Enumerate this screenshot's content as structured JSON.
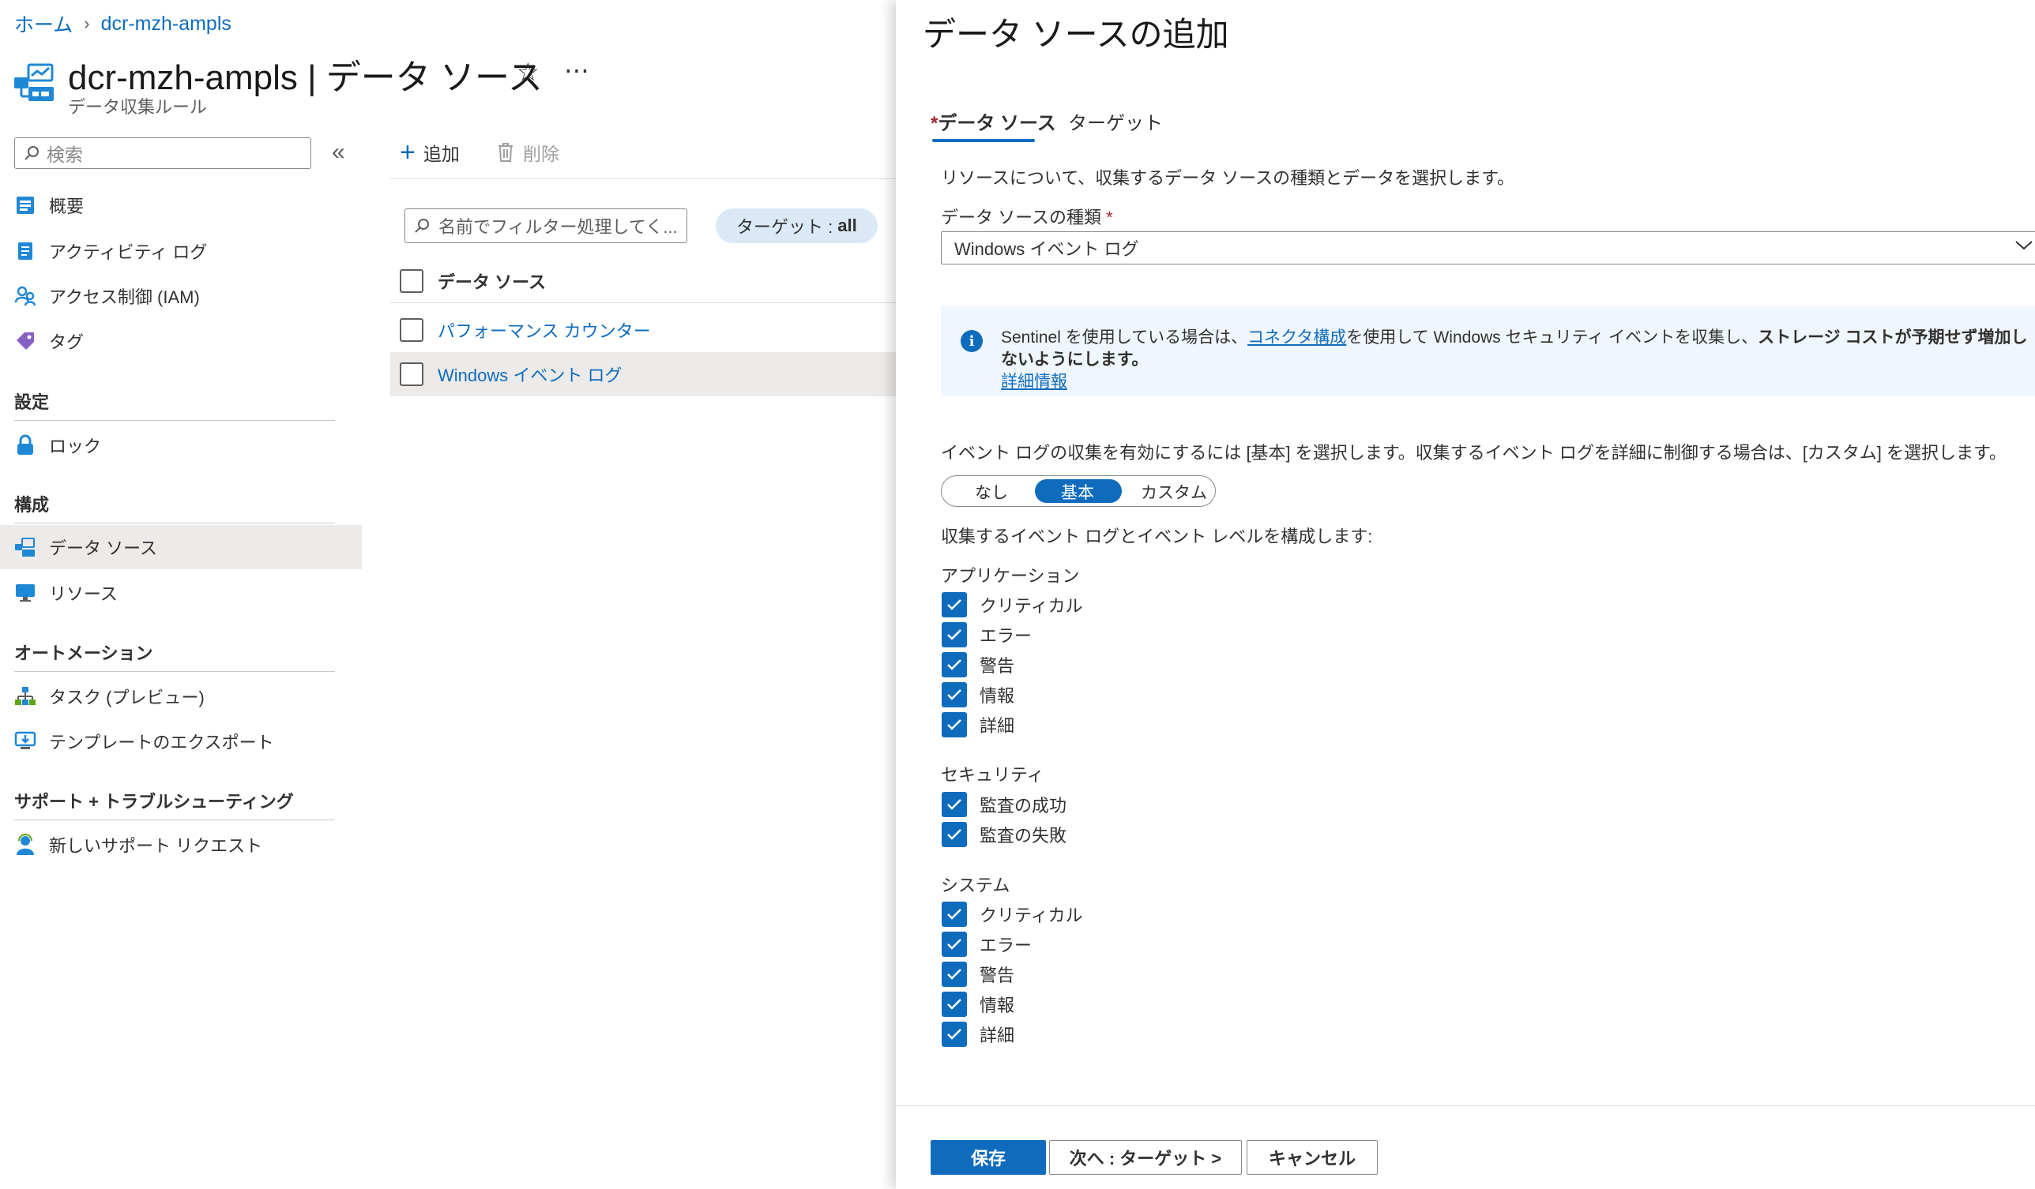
{
  "breadcrumb": {
    "home": "ホーム",
    "resource": "dcr-mzh-ampls"
  },
  "header": {
    "title": "dcr-mzh-ampls | データ ソース",
    "subtitle": "データ収集ルール"
  },
  "sidebar": {
    "search_placeholder": "検索",
    "items_top": [
      {
        "label": "概要",
        "icon": "overview-icon"
      },
      {
        "label": "アクティビティ ログ",
        "icon": "activity-log-icon"
      },
      {
        "label": "アクセス制御 (IAM)",
        "icon": "iam-icon"
      },
      {
        "label": "タグ",
        "icon": "tag-icon"
      }
    ],
    "sections": {
      "settings": "設定",
      "config": "構成",
      "automation": "オートメーション",
      "support": "サポート + トラブルシューティング"
    },
    "settings_items": [
      {
        "label": "ロック",
        "icon": "lock-icon"
      }
    ],
    "config_items": [
      {
        "label": "データ ソース",
        "icon": "data-source-icon",
        "active": true
      },
      {
        "label": "リソース",
        "icon": "resource-icon"
      }
    ],
    "automation_items": [
      {
        "label": "タスク (プレビュー)",
        "icon": "tasks-icon"
      },
      {
        "label": "テンプレートのエクスポート",
        "icon": "export-template-icon"
      }
    ],
    "support_items": [
      {
        "label": "新しいサポート リクエスト",
        "icon": "support-request-icon"
      }
    ]
  },
  "toolbar": {
    "add_label": "追加",
    "delete_label": "削除"
  },
  "list": {
    "filter_placeholder": "名前でフィルター処理してく...",
    "target_filter_label": "ターゲット :",
    "target_filter_value": "all",
    "column_header": "データ ソース",
    "rows": [
      "パフォーマンス カウンター",
      "Windows イベント ログ"
    ]
  },
  "pane": {
    "title": "データ ソースの追加",
    "tabs": {
      "datasource": "データ ソース",
      "target": "ターゲット"
    },
    "description": "リソースについて、収集するデータ ソースの種類とデータを選択します。",
    "type_label": "データ ソースの種類",
    "type_value": "Windows イベント ログ",
    "info": {
      "text1": "Sentinel を使用している場合は、",
      "link1": "コネクタ構成",
      "text2": "を使用して Windows セキュリティ イベントを収集し、",
      "bold": "ストレージ コストが予期せず増加しないようにします。",
      "link2": "詳細情報"
    },
    "hint": "イベント ログの収集を有効にするには [基本] を選択します。収集するイベント ログを詳細に制御する場合は、[カスタム] を選択します。",
    "mode_options": [
      "なし",
      "基本",
      "カスタム"
    ],
    "mode_selected": "基本",
    "config_text": "収集するイベント ログとイベント レベルを構成します:",
    "groups": {
      "application": {
        "label": "アプリケーション",
        "items": [
          "クリティカル",
          "エラー",
          "警告",
          "情報",
          "詳細"
        ]
      },
      "security": {
        "label": "セキュリティ",
        "items": [
          "監査の成功",
          "監査の失敗"
        ]
      },
      "system": {
        "label": "システム",
        "items": [
          "クリティカル",
          "エラー",
          "警告",
          "情報",
          "詳細"
        ]
      }
    },
    "buttons": {
      "save": "保存",
      "next": "次へ : ターゲット >",
      "cancel": "キャンセル"
    }
  },
  "colors": {
    "accent": "#0f6cbd",
    "info_bg": "#f0f6fd",
    "selected_row": "#edebe9"
  }
}
